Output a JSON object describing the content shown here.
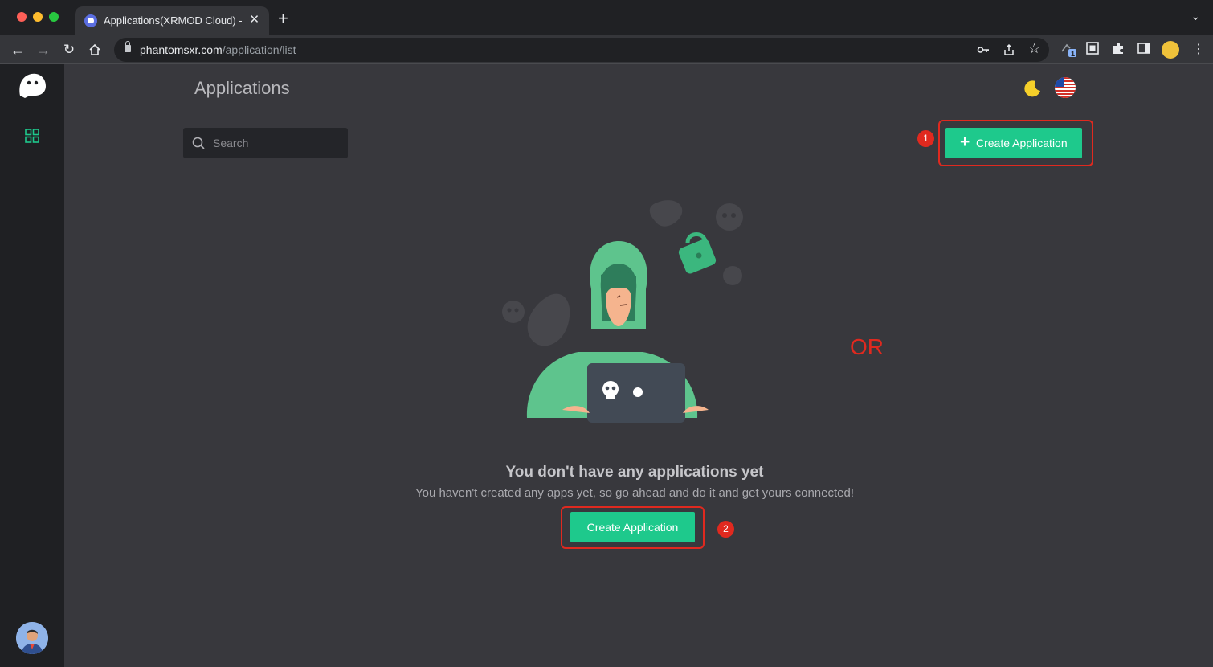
{
  "browser": {
    "tab_title": "Applications(XRMOD Cloud) - ",
    "tab_close": "✕",
    "new_tab": "+",
    "url_host": "phantomsxr.com",
    "url_path": "/application/list",
    "extension_badge": "1"
  },
  "sidebar": {
    "items": [
      {
        "icon": "grid-icon",
        "label": "Applications"
      }
    ]
  },
  "header": {
    "title": "Applications"
  },
  "search": {
    "placeholder": "Search"
  },
  "actions": {
    "create_top_label": "Create Application",
    "create_top_plus": "+",
    "create_center_label": "Create Application"
  },
  "empty_state": {
    "title": "You don't have any applications yet",
    "subtitle": "You haven't created any apps yet, so go ahead and do it and get yours connected!"
  },
  "annotations": {
    "marker_1": "1",
    "marker_2": "2",
    "or": "OR"
  },
  "colors": {
    "accent": "#1ec98c",
    "highlight": "#e0291f",
    "background": "#38383d",
    "sidebar": "#1f2023"
  }
}
